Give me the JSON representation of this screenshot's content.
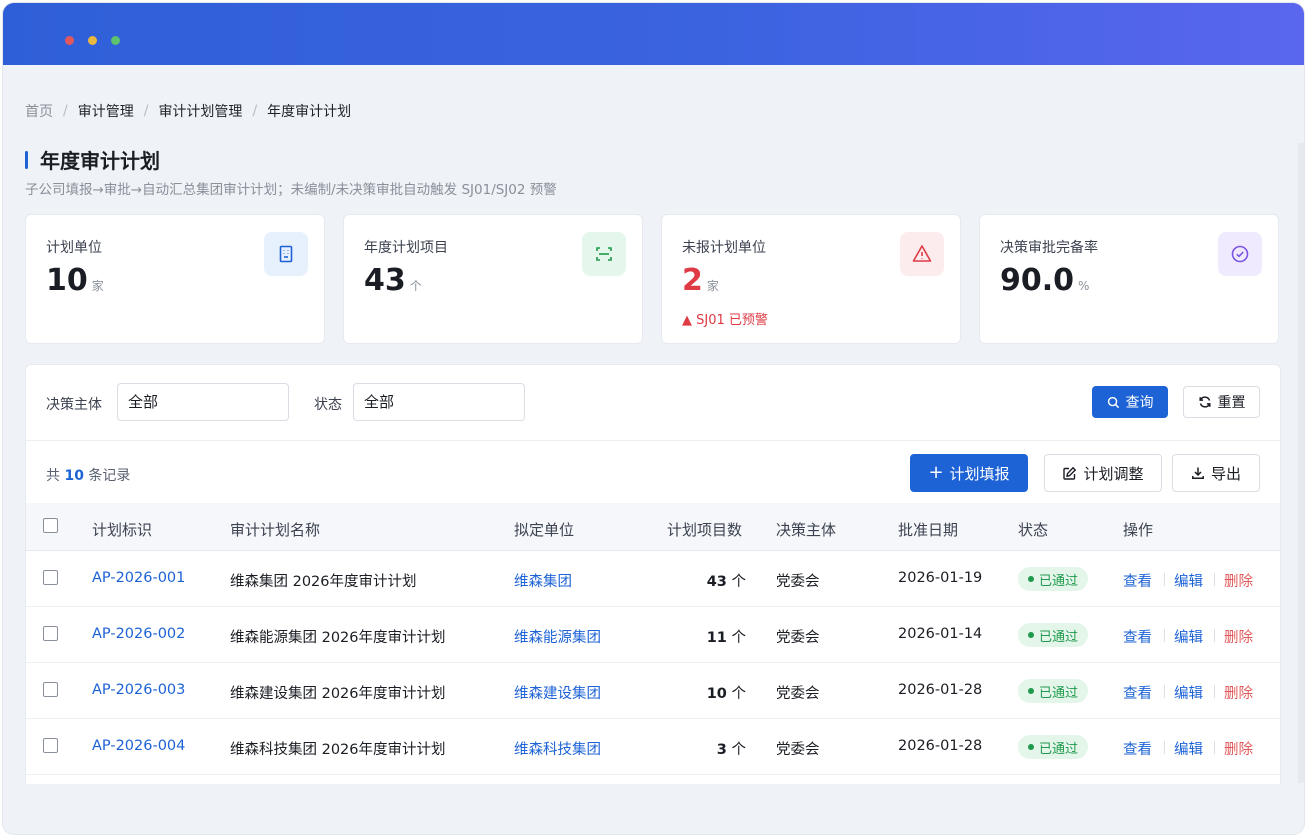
{
  "breadcrumb": [
    "首页",
    "审计管理",
    "审计计划管理",
    "年度审计计划"
  ],
  "page": {
    "title": "年度审计计划",
    "subtitle": "子公司填报→审批→自动汇总集团审计计划；未编制/未决策审批自动触发 SJ01/SJ02 预警"
  },
  "stats": [
    {
      "label": "计划单位",
      "value": "10",
      "unit": "家",
      "icon": "building-icon",
      "accent": "#1d63d6"
    },
    {
      "label": "年度计划项目",
      "value": "43",
      "unit": "个",
      "icon": "scan-icon",
      "accent": "#1f9a4c"
    },
    {
      "label": "未报计划单位",
      "value": "2",
      "unit": "家",
      "warning": "▲ SJ01 已预警",
      "icon": "alert-triangle-icon",
      "accent": "#de3b45"
    },
    {
      "label": "决策审批完备率",
      "value": "90.0",
      "unit": "%",
      "icon": "check-circle-icon",
      "accent": "#7b55e6"
    }
  ],
  "filters": {
    "decision_label": "决策主体",
    "decision_value": "全部",
    "status_label": "状态",
    "status_value": "全部",
    "query_label": "查询",
    "reset_label": "重置"
  },
  "toolbar": {
    "count_prefix": "共",
    "count": "10",
    "count_suffix": "条记录",
    "add_label": "计划填报",
    "adjust_label": "计划调整",
    "export_label": "导出"
  },
  "table": {
    "headers": [
      "计划标识",
      "审计计划名称",
      "拟定单位",
      "计划项目数",
      "决策主体",
      "批准日期",
      "状态",
      "操作"
    ],
    "rows": [
      {
        "id": "AP-2026-001",
        "name": "维森集团 2026年度审计计划",
        "unit": "维森集团",
        "count": "43",
        "count_unit": "个",
        "decision": "党委会",
        "date": "2026-01-19",
        "status": "已通过"
      },
      {
        "id": "AP-2026-002",
        "name": "维森能源集团 2026年度审计计划",
        "unit": "维森能源集团",
        "count": "11",
        "count_unit": "个",
        "decision": "党委会",
        "date": "2026-01-14",
        "status": "已通过"
      },
      {
        "id": "AP-2026-003",
        "name": "维森建设集团 2026年度审计计划",
        "unit": "维森建设集团",
        "count": "10",
        "count_unit": "个",
        "decision": "党委会",
        "date": "2026-01-28",
        "status": "已通过"
      },
      {
        "id": "AP-2026-004",
        "name": "维森科技集团 2026年度审计计划",
        "unit": "维森科技集团",
        "count": "3",
        "count_unit": "个",
        "decision": "党委会",
        "date": "2026-01-28",
        "status": "已通过"
      }
    ],
    "ops": {
      "view": "查看",
      "edit": "编辑",
      "delete": "删除"
    }
  }
}
